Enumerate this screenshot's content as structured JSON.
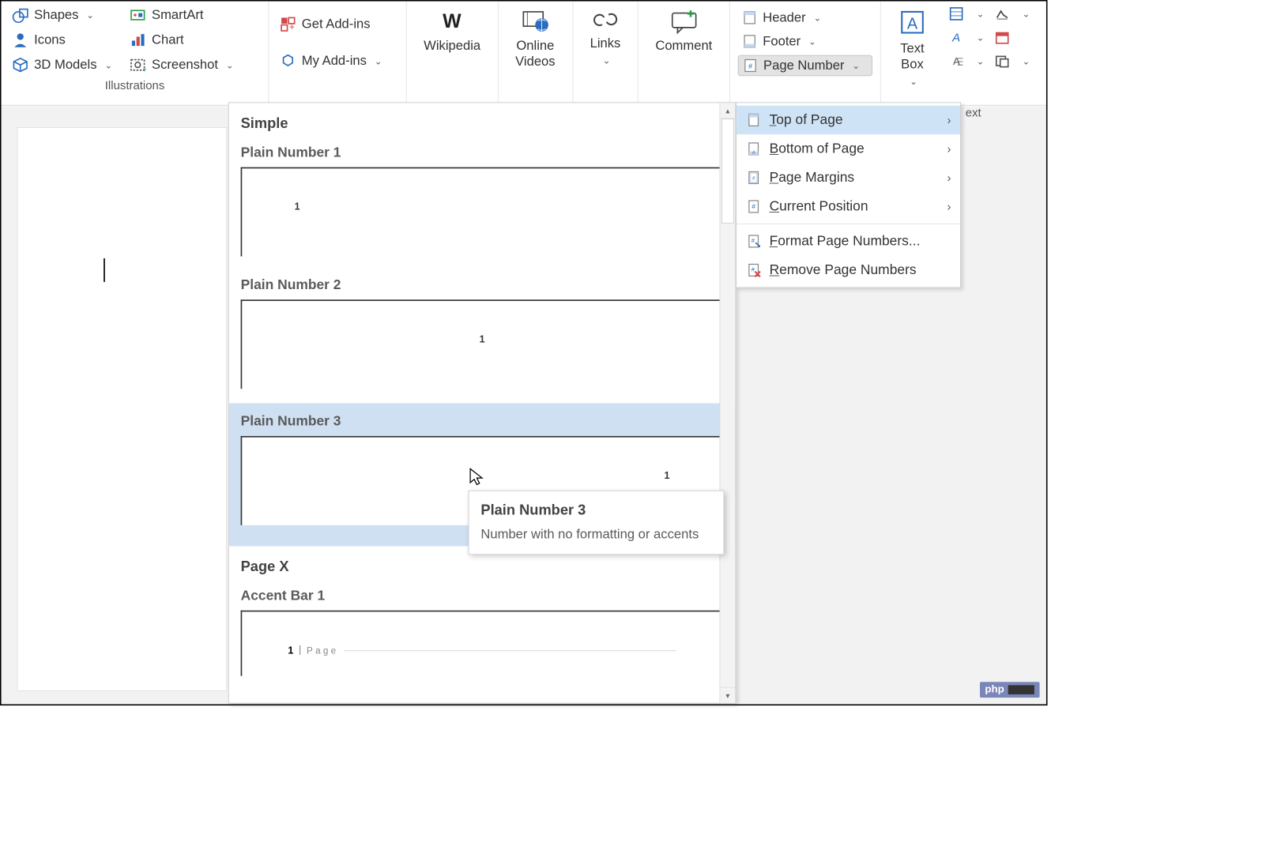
{
  "ribbon": {
    "illustrations": {
      "shapes": "Shapes",
      "icons": "Icons",
      "models3d": "3D Models",
      "smartart": "SmartArt",
      "chart": "Chart",
      "screenshot": "Screenshot",
      "group_label": "Illustrations"
    },
    "addins": {
      "get": "Get Add-ins",
      "my": "My Add-ins"
    },
    "wikipedia": "Wikipedia",
    "online_videos": "Online\nVideos",
    "links": "Links",
    "comment": "Comment",
    "header_footer": {
      "header": "Header",
      "footer": "Footer",
      "page_number": "Page Number"
    },
    "text_box": "Text\nBox",
    "text_group_label": "ext"
  },
  "dropdown": {
    "items": [
      {
        "label": "Top of Page",
        "key": "T",
        "submenu": true,
        "hover": true
      },
      {
        "label": "Bottom of Page",
        "key": "B",
        "submenu": true
      },
      {
        "label": "Page Margins",
        "key": "P",
        "submenu": true
      },
      {
        "label": "Current Position",
        "key": "C",
        "submenu": true
      },
      {
        "label": "Format Page Numbers...",
        "key": "F",
        "submenu": false
      },
      {
        "label": "Remove Page Numbers",
        "key": "R",
        "submenu": false
      }
    ]
  },
  "gallery": {
    "sections": [
      {
        "title": "Simple",
        "items": [
          {
            "title": "Plain Number 1",
            "align": "left",
            "number": "1"
          },
          {
            "title": "Plain Number 2",
            "align": "center",
            "number": "1"
          },
          {
            "title": "Plain Number 3",
            "align": "right",
            "number": "1",
            "selected": true
          }
        ]
      },
      {
        "title": "Page X",
        "items": [
          {
            "title": "Accent Bar 1",
            "variant": "accent",
            "number": "1",
            "page_word": "Page"
          }
        ]
      }
    ]
  },
  "tooltip": {
    "title": "Plain Number 3",
    "desc": "Number with no formatting or accents"
  },
  "badge": "php"
}
